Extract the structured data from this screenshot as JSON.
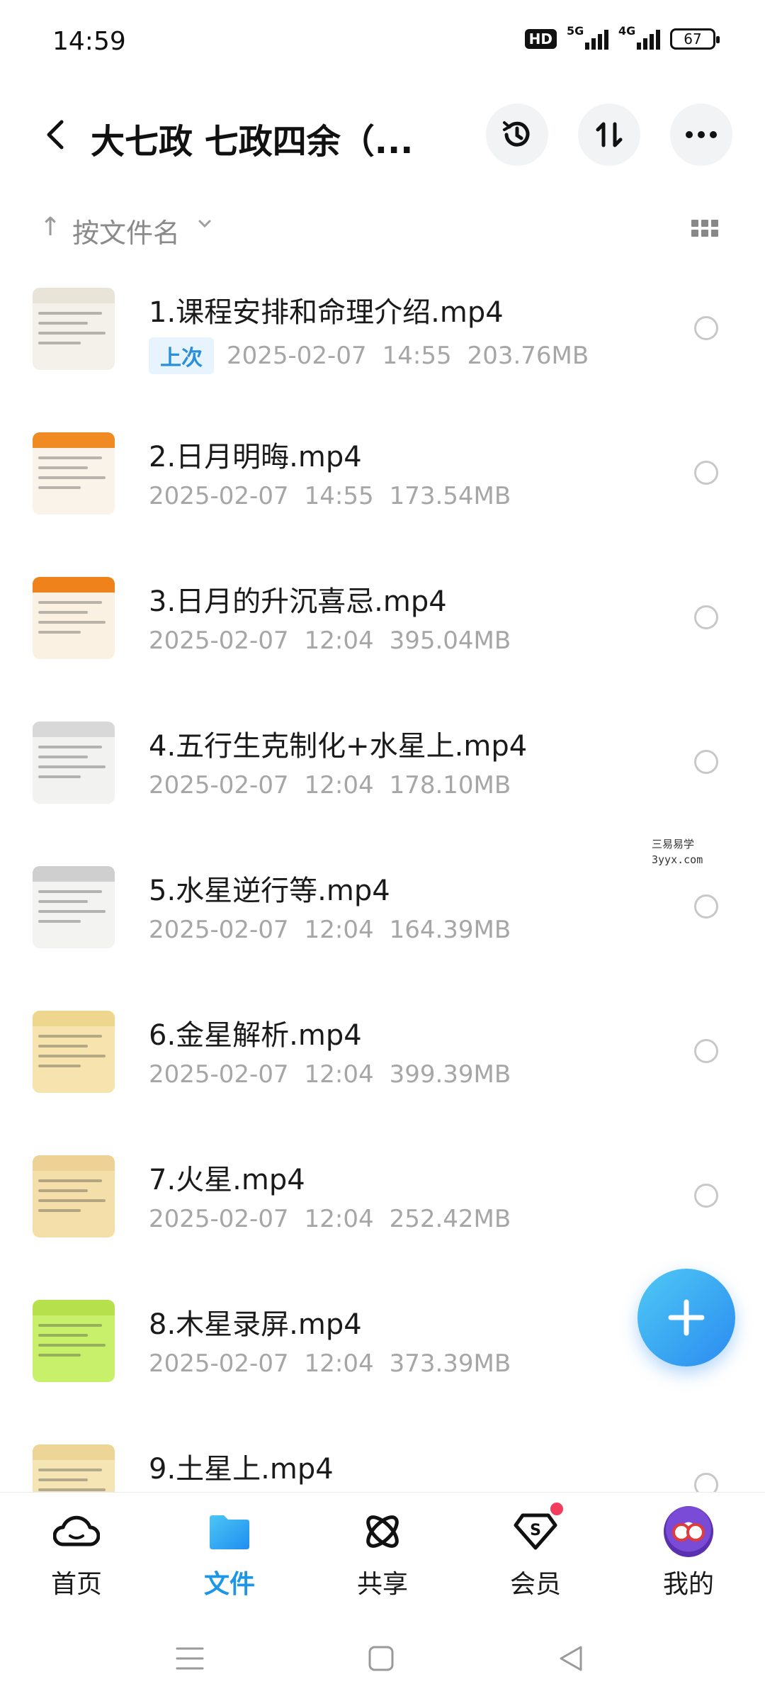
{
  "status_bar": {
    "time": "14:59",
    "hd_label": "HD",
    "net1": "5G",
    "net2": "4G",
    "battery": "67"
  },
  "header": {
    "title": "大七政 七政四余（..."
  },
  "sort": {
    "label": "按文件名"
  },
  "files": [
    {
      "name": "1.课程安排和命理介绍.mp4",
      "tag": "上次",
      "date": "2025-02-07",
      "time": "14:55",
      "size": "203.76MB",
      "thumb_color": "#f4f1ea",
      "band_color": "#e9e4d8"
    },
    {
      "name": "2.日月明晦.mp4",
      "tag": "",
      "date": "2025-02-07",
      "time": "14:55",
      "size": "173.54MB",
      "thumb_color": "#faf3ea",
      "band_color": "#f08a22"
    },
    {
      "name": "3.日月的升沉喜忌.mp4",
      "tag": "",
      "date": "2025-02-07",
      "time": "12:04",
      "size": "395.04MB",
      "thumb_color": "#fbf1e2",
      "band_color": "#f0821c"
    },
    {
      "name": "4.五行生克制化+水星上.mp4",
      "tag": "",
      "date": "2025-02-07",
      "time": "12:04",
      "size": "178.10MB",
      "thumb_color": "#f2f2f0",
      "band_color": "#d8d8d8"
    },
    {
      "name": "5.水星逆行等.mp4",
      "tag": "",
      "date": "2025-02-07",
      "time": "12:04",
      "size": "164.39MB",
      "thumb_color": "#f3f3f1",
      "band_color": "#cfcfcf"
    },
    {
      "name": "6.金星解析.mp4",
      "tag": "",
      "date": "2025-02-07",
      "time": "12:04",
      "size": "399.39MB",
      "thumb_color": "#f6e3ad",
      "band_color": "#efd68e"
    },
    {
      "name": "7.火星.mp4",
      "tag": "",
      "date": "2025-02-07",
      "time": "12:04",
      "size": "252.42MB",
      "thumb_color": "#f4deaa",
      "band_color": "#eed194"
    },
    {
      "name": "8.木星录屏.mp4",
      "tag": "",
      "date": "2025-02-07",
      "time": "12:04",
      "size": "373.39MB",
      "thumb_color": "#c8f06a",
      "band_color": "#b6e04c"
    },
    {
      "name": "9.土星上.mp4",
      "tag": "",
      "date": "",
      "time": "",
      "size": "",
      "thumb_color": "#f5e4b4",
      "band_color": "#ecd596"
    }
  ],
  "watermark": {
    "line1": "三易易学",
    "line2": "3yyx.com"
  },
  "tabs": [
    {
      "label": "首页",
      "icon": "cloud-icon"
    },
    {
      "label": "文件",
      "icon": "folder-icon"
    },
    {
      "label": "共享",
      "icon": "share-orbit-icon"
    },
    {
      "label": "会员",
      "icon": "vip-s-icon"
    },
    {
      "label": "我的",
      "icon": "avatar-icon"
    }
  ],
  "colors": {
    "accent": "#1e96e8",
    "tag_bg": "#e8f4fd",
    "badge": "#f23d5c"
  }
}
